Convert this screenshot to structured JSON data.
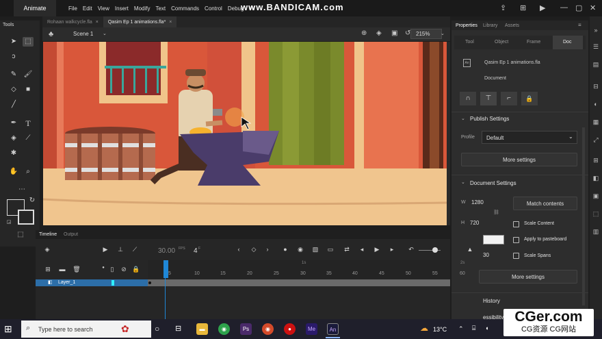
{
  "app": {
    "name": "Animate",
    "menus": [
      "File",
      "Edit",
      "View",
      "Insert",
      "Modify",
      "Text",
      "Commands",
      "Control",
      "Debug",
      "W"
    ],
    "watermark": "www.BANDICAM.com"
  },
  "doc_tabs": [
    {
      "label": "Rohaan walkcycle.fla",
      "active": false
    },
    {
      "label": "Qasim Ep 1 animations.fla*",
      "active": true
    }
  ],
  "scene": {
    "label": "Scene 1",
    "zoom": "215%"
  },
  "tools_panel": {
    "title": "Tools"
  },
  "properties": {
    "tabs": [
      "Properties",
      "Library",
      "Assets"
    ],
    "subtabs": [
      "Tool",
      "Object",
      "Frame",
      "Doc"
    ],
    "doc_name": "Qasim Ep 1 animations.fla",
    "doc_type": "Document",
    "publish": {
      "title": "Publish Settings",
      "profile_label": "Profile",
      "profile_value": "Default",
      "more_button": "More settings"
    },
    "document_settings": {
      "title": "Document Settings",
      "w_label": "W",
      "w_value": "1280",
      "h_label": "H",
      "h_value": "720",
      "match_button": "Match contents",
      "scale_content": "Scale Content",
      "apply_pasteboard": "Apply to pasteboard",
      "scale_spans": "Scale Spans",
      "fps_fragment": "30",
      "more_button": "More settings"
    },
    "history_title": "History",
    "accessibility_fragment": "essibility"
  },
  "timeline": {
    "tabs": [
      "Timeline",
      "Output"
    ],
    "fps": "30.00",
    "fps_unit": "FPS",
    "frame": "4",
    "frame_unit": "F",
    "ruler": [
      "5",
      "10",
      "15",
      "20",
      "25",
      "30",
      "35",
      "40",
      "45",
      "50",
      "55",
      "60"
    ],
    "sec_marks": [
      "1s",
      "2s"
    ],
    "layer_name": "Layer_1"
  },
  "taskbar": {
    "search_placeholder": "Type here to search",
    "temperature": "13°C"
  },
  "overlay": {
    "title": "CGer.com",
    "subtitle": "CG资源 CG网站"
  }
}
